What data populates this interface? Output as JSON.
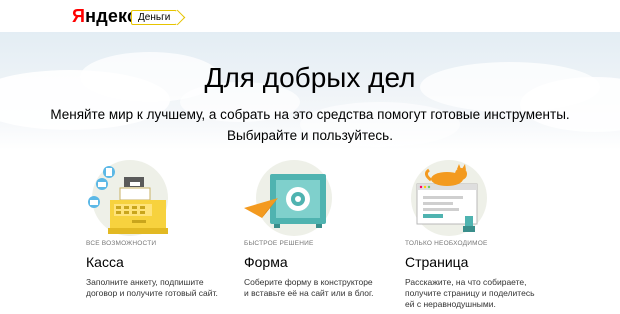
{
  "header": {
    "logo_ya": "Я",
    "logo_rest": "ндекс",
    "service_badge": "Деньги"
  },
  "hero": {
    "title": "Для добрых дел",
    "subtitle_line1": "Меняйте мир к лучшему, а собрать на это средства помогут готовые инструменты.",
    "subtitle_line2": "Выбирайте и пользуйтесь."
  },
  "features": [
    {
      "caption": "все возможности",
      "name": "Касса",
      "desc_line1": "Заполните анкету, подпишите",
      "desc_line2": "договор и получите готовый сайт.",
      "icon": "cash-register-icon"
    },
    {
      "caption": "быстрое решение",
      "name": "Форма",
      "desc_line1": "Соберите форму в конструкторе",
      "desc_line2": "и вставьте её на сайт или в блог.",
      "icon": "safe-paper-plane-icon"
    },
    {
      "caption": "только необходимое",
      "name": "Страница",
      "desc_line1": "Расскажите, на что собираете,",
      "desc_line2": "получите страницу и поделитесь",
      "desc_line3": "ей с неравнодушными.",
      "icon": "browser-cat-icon"
    }
  ],
  "colors": {
    "brand_red": "#ff0000",
    "badge_border": "#e6c400",
    "illustration_bg": "#eef0e8",
    "yellow": "#f7d23e",
    "teal": "#4fb3b0",
    "orange": "#f39a1f"
  }
}
